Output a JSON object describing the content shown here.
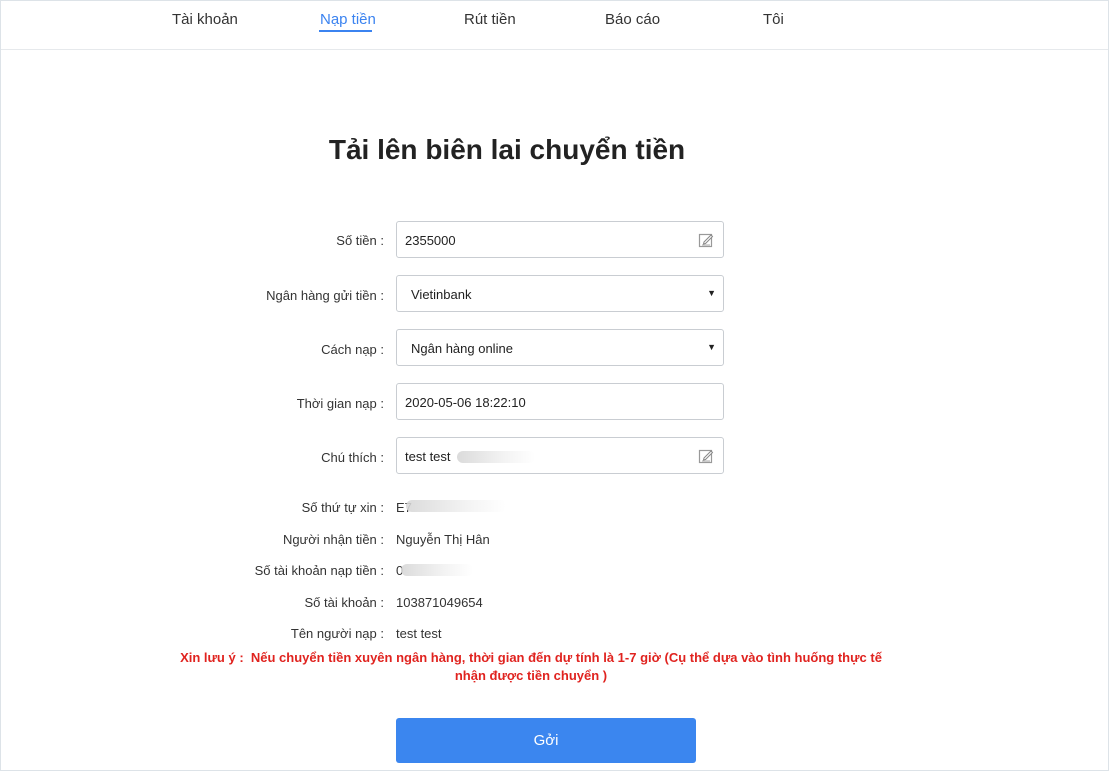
{
  "nav": {
    "items": [
      {
        "label": "Tài khoản",
        "active": false
      },
      {
        "label": "Nạp tiền",
        "active": true
      },
      {
        "label": "Rút tiền",
        "active": false
      },
      {
        "label": "Báo cáo",
        "active": false
      },
      {
        "label": "Tôi",
        "active": false
      }
    ]
  },
  "page_title": "Tải lên biên lai chuyển tiền",
  "form": {
    "amount": {
      "label": "Số tiền :",
      "value": "2355000",
      "icon": "edit-icon"
    },
    "bank": {
      "label": "Ngân hàng gửi tiền :",
      "value": "Vietinbank",
      "icon": "dropdown-caret-icon"
    },
    "method": {
      "label": "Cách nạp :",
      "value": "Ngân hàng online",
      "icon": "dropdown-caret-icon"
    },
    "time": {
      "label": "Thời gian nạp :",
      "value": "2020-05-06 18:22:10"
    },
    "remark": {
      "label": "Chú thích :",
      "value": "test test",
      "icon": "edit-icon"
    }
  },
  "info": {
    "order_no": {
      "label": "Số thứ tự xin :",
      "value": "E7"
    },
    "receiver": {
      "label": "Người nhận tiền :",
      "value": "Nguyễn Thị Hân"
    },
    "deposit_account": {
      "label": "Số tài khoản nạp tiền :",
      "value": "0"
    },
    "account_no": {
      "label": "Số tài khoản :",
      "value": "103871049654"
    },
    "depositor": {
      "label": "Tên người nạp :",
      "value": "test test"
    }
  },
  "notice": {
    "prefix": "Xin lưu ý :",
    "text": "Nếu chuyển tiền xuyên ngân hàng, thời gian đến dự tính là 1-7 giờ (Cụ thể dựa vào tình huống thực tế nhận được tiền chuyển )"
  },
  "submit_label": "Gởi",
  "colors": {
    "accent": "#3b86ef",
    "warning": "#e0231f"
  }
}
